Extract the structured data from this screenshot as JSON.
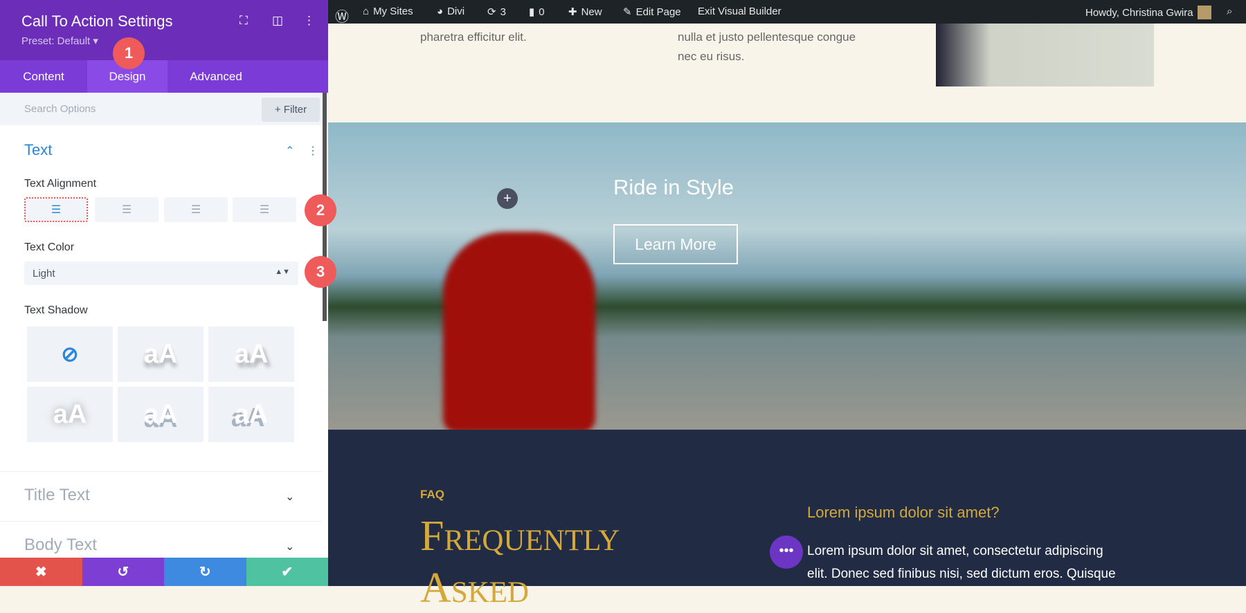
{
  "panel": {
    "title": "Call To Action Settings",
    "preset": "Preset: Default ▾",
    "tabs": [
      "Content",
      "Design",
      "Advanced"
    ],
    "active_tab": "Design",
    "search_placeholder": "Search Options",
    "filter_label": "+ Filter",
    "section": "Text",
    "text_alignment_label": "Text Alignment",
    "alignment_selected": "left",
    "text_color_label": "Text Color",
    "text_color_value": "Light",
    "text_shadow_label": "Text Shadow",
    "shadow_sample": "aA",
    "collapsed": [
      "Title Text",
      "Body Text"
    ],
    "footer_colors": [
      "#e3534c",
      "#7c3ed3",
      "#3d8ae0",
      "#4fc3a1"
    ]
  },
  "badges": [
    "1",
    "2",
    "3"
  ],
  "admin_bar": {
    "my_sites": "My Sites",
    "divi": "Divi",
    "updates": "3",
    "comments": "0",
    "new": "New",
    "edit_page": "Edit Page",
    "exit_builder": "Exit Visual Builder",
    "howdy": "Howdy, Christina Gwira"
  },
  "page": {
    "col1": "pharetra efficitur elit.",
    "col2_line1": "nulla et justo pellentesque congue",
    "col2_line2": "nec eu risus.",
    "cta_title": "Ride in Style",
    "cta_button": "Learn More",
    "faq_label": "FAQ",
    "faq_heading_1": "Frequently",
    "faq_heading_2": "Asked",
    "question": "Lorem ipsum dolor sit amet?",
    "answer_1": "Lorem ipsum dolor sit amet, consectetur adipiscing",
    "answer_2": "elit. Donec sed finibus nisi, sed dictum eros. Quisque"
  }
}
